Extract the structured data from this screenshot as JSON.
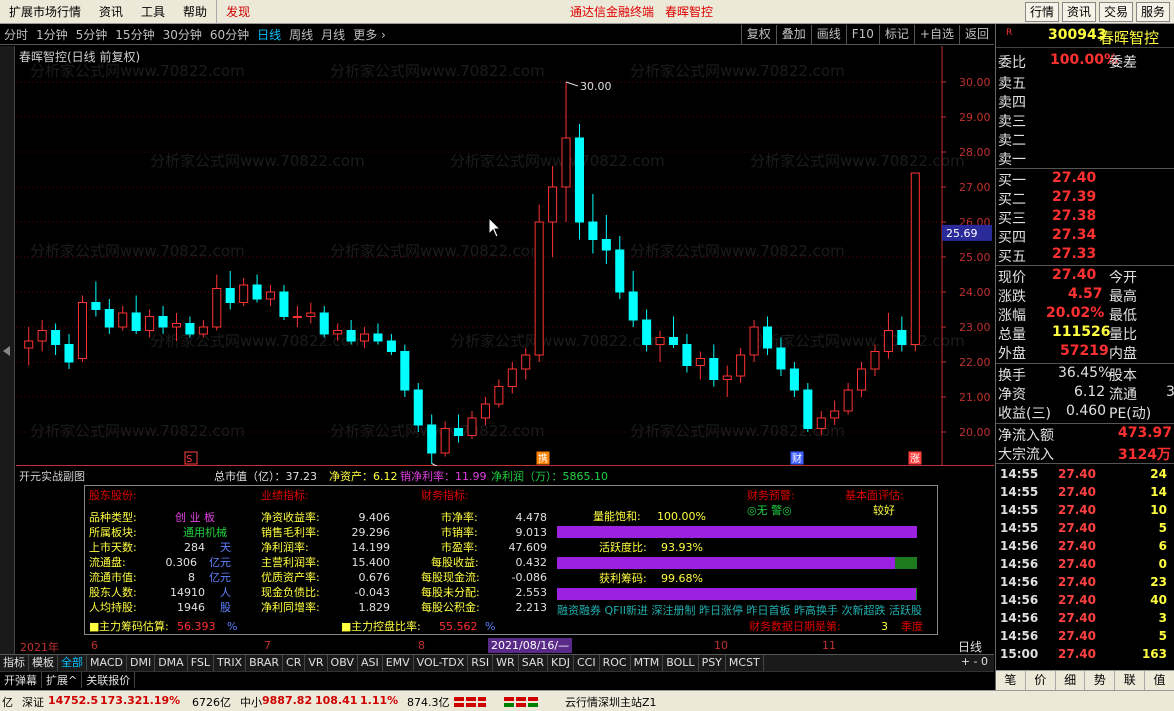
{
  "menu": {
    "items": [
      "扩展市场行情",
      "资讯",
      "工具",
      "帮助"
    ],
    "find": "发现",
    "promo1": "通达信金融终端",
    "promo2": "春晖智控",
    "right_buttons": [
      "行情",
      "资讯",
      "交易",
      "服务"
    ]
  },
  "periods": [
    "分时",
    "1分钟",
    "5分钟",
    "15分钟",
    "30分钟",
    "60分钟",
    "日线",
    "周线",
    "月线",
    "更多 ›"
  ],
  "active_period": "日线",
  "tools": [
    "复权",
    "叠加",
    "画线",
    "F10",
    "标记",
    "+自选",
    "返回"
  ],
  "chart_title": "春晖智控(日线 前复权)",
  "watermark": "分析家公式网www.70822.com",
  "colors": {
    "up": "#ff3232",
    "down": "#00ffff",
    "axis": "#c03030",
    "grid": "#600000",
    "purple": "#9a22e0"
  },
  "chart_data": {
    "type": "candlestick",
    "title": "春晖智控(日线 前复权)",
    "ylim": [
      19.02,
      30.0
    ],
    "yticks": [
      "30.00",
      "29.00",
      "28.00",
      "27.00",
      "26.00",
      "25.00",
      "24.00",
      "23.00",
      "22.00",
      "21.00",
      "20.00"
    ],
    "last_price_label": "25.69",
    "high_marker": "30.00",
    "low_marker": "19.02",
    "candles": [
      [
        22.4,
        23.0,
        21.9,
        22.6
      ],
      [
        22.6,
        23.2,
        22.3,
        22.9
      ],
      [
        22.9,
        23.1,
        22.2,
        22.5
      ],
      [
        22.5,
        22.8,
        21.8,
        22.0
      ],
      [
        22.1,
        23.9,
        22.0,
        23.7
      ],
      [
        23.7,
        24.3,
        23.3,
        23.5
      ],
      [
        23.5,
        23.8,
        22.8,
        23.0
      ],
      [
        23.0,
        23.6,
        22.9,
        23.4
      ],
      [
        23.4,
        23.9,
        22.8,
        22.9
      ],
      [
        22.9,
        23.5,
        22.7,
        23.3
      ],
      [
        23.3,
        23.6,
        22.8,
        23.0
      ],
      [
        23.0,
        23.4,
        22.6,
        23.1
      ],
      [
        23.1,
        23.3,
        22.7,
        22.8
      ],
      [
        22.8,
        23.2,
        22.7,
        23.0
      ],
      [
        23.0,
        24.5,
        22.9,
        24.1
      ],
      [
        24.1,
        24.6,
        23.5,
        23.7
      ],
      [
        23.7,
        24.4,
        23.6,
        24.2
      ],
      [
        24.2,
        24.5,
        23.7,
        23.8
      ],
      [
        23.8,
        24.2,
        23.6,
        24.0
      ],
      [
        24.0,
        24.2,
        23.2,
        23.3
      ],
      [
        23.3,
        23.6,
        23.0,
        23.3
      ],
      [
        23.3,
        23.7,
        23.1,
        23.4
      ],
      [
        23.4,
        23.6,
        22.7,
        22.8
      ],
      [
        22.8,
        23.1,
        22.6,
        22.9
      ],
      [
        22.9,
        23.2,
        22.5,
        22.6
      ],
      [
        22.6,
        23.0,
        22.4,
        22.8
      ],
      [
        22.8,
        23.1,
        22.5,
        22.6
      ],
      [
        22.6,
        22.8,
        22.2,
        22.3
      ],
      [
        22.3,
        22.5,
        21.0,
        21.2
      ],
      [
        21.2,
        21.4,
        20.0,
        20.2
      ],
      [
        20.2,
        20.5,
        19.1,
        19.4
      ],
      [
        19.4,
        20.3,
        19.3,
        20.1
      ],
      [
        20.1,
        20.5,
        19.7,
        19.9
      ],
      [
        19.9,
        20.6,
        19.8,
        20.4
      ],
      [
        20.4,
        21.0,
        20.2,
        20.8
      ],
      [
        20.8,
        21.5,
        20.7,
        21.3
      ],
      [
        21.3,
        22.0,
        21.1,
        21.8
      ],
      [
        21.8,
        22.4,
        21.5,
        22.2
      ],
      [
        22.2,
        26.5,
        22.0,
        26.0
      ],
      [
        26.0,
        27.6,
        25.0,
        27.0
      ],
      [
        27.0,
        30.0,
        26.0,
        28.4
      ],
      [
        28.4,
        28.8,
        25.5,
        26.0
      ],
      [
        26.0,
        26.8,
        25.1,
        25.5
      ],
      [
        25.5,
        26.2,
        24.8,
        25.2
      ],
      [
        25.2,
        25.6,
        23.8,
        24.0
      ],
      [
        24.0,
        24.6,
        23.0,
        23.2
      ],
      [
        23.2,
        23.5,
        22.3,
        22.5
      ],
      [
        22.5,
        22.9,
        22.0,
        22.7
      ],
      [
        22.7,
        23.3,
        22.4,
        22.5
      ],
      [
        22.5,
        22.8,
        21.7,
        21.9
      ],
      [
        21.9,
        22.3,
        21.5,
        22.1
      ],
      [
        22.1,
        22.5,
        21.3,
        21.5
      ],
      [
        21.5,
        21.9,
        21.0,
        21.6
      ],
      [
        21.6,
        22.4,
        21.4,
        22.2
      ],
      [
        22.2,
        23.2,
        22.0,
        23.0
      ],
      [
        23.0,
        23.3,
        22.2,
        22.4
      ],
      [
        22.4,
        22.7,
        21.6,
        21.8
      ],
      [
        21.8,
        22.0,
        21.0,
        21.2
      ],
      [
        21.2,
        21.4,
        20.0,
        20.1
      ],
      [
        20.1,
        20.6,
        19.9,
        20.4
      ],
      [
        20.4,
        20.9,
        20.2,
        20.6
      ],
      [
        20.6,
        21.4,
        20.5,
        21.2
      ],
      [
        21.2,
        22.0,
        21.0,
        21.8
      ],
      [
        21.8,
        22.5,
        21.6,
        22.3
      ],
      [
        22.3,
        23.4,
        22.1,
        22.9
      ],
      [
        22.9,
        23.3,
        22.3,
        22.5
      ],
      [
        22.5,
        27.4,
        22.3,
        27.4
      ]
    ]
  },
  "markers": {
    "s": "S",
    "ex": "携",
    "cai": "财",
    "zhang": "涨"
  },
  "fund": {
    "title": "开元实战副图",
    "mktcap": "总市值（亿）：37.23",
    "netasset": "净资产：6.12",
    "grossrate": "销净利率：11.99",
    "netprofit": "净利润（万）：5865.10",
    "h1": "股东股份:",
    "h2": "业绩指标:",
    "h3": "财务指标:",
    "h4": "财务预警:",
    "h5": "基本面评估:",
    "warn": "◎无 警◎",
    "eval": "较好",
    "c1": [
      [
        "品种类型:",
        "创 业 板",
        ""
      ],
      [
        "所属板块:",
        "通用机械",
        ""
      ],
      [
        "上市天数:",
        "284",
        "天"
      ],
      [
        "流通盘:",
        "0.306",
        "亿元"
      ],
      [
        "流通市值:",
        "8",
        "亿元"
      ],
      [
        "股东人数:",
        "14910",
        "人"
      ],
      [
        "人均持股:",
        "1946",
        "股"
      ]
    ],
    "c2": [
      [
        "净资收益率:",
        "9.406"
      ],
      [
        "销售毛利率:",
        "29.296"
      ],
      [
        "净利润率:",
        "14.199"
      ],
      [
        "主营利润率:",
        "15.400"
      ],
      [
        "优质资产率:",
        "0.676"
      ],
      [
        "现金负债比:",
        "-0.043"
      ],
      [
        "净利同增率:",
        "1.829"
      ]
    ],
    "c3": [
      [
        "市净率:",
        "4.478"
      ],
      [
        "市销率:",
        "9.013"
      ],
      [
        "市盈率:",
        "47.609"
      ],
      [
        "每股收益:",
        "0.432"
      ],
      [
        "每股现金流:",
        "-0.086"
      ],
      [
        "每股未分配:",
        "2.553"
      ],
      [
        "每股公积金:",
        "2.213"
      ]
    ],
    "bars": [
      {
        "label": "量能饱和:",
        "pct": "100.00%",
        "fill": 1.0
      },
      {
        "label": "活跃度比:",
        "pct": "93.93%",
        "fill": 0.9393
      },
      {
        "label": "获利筹码:",
        "pct": "99.68%",
        "fill": 0.9968
      }
    ],
    "scroller": "融资融券 QFII新进 深注册制 昨日涨停 昨日首板 昨高换手 次新超跌 活跃股",
    "chip1": "主力筹码估算:",
    "chip1v": "56.393",
    "chip1u": "%",
    "chip2": "主力控盘比率:",
    "chip2v": "55.562",
    "chip2u": "%",
    "reportdate": "财务数据日期是第:",
    "reportq": "3",
    "reportu": "季度"
  },
  "timeaxis": {
    "labels": [
      "2021年",
      "6",
      "7",
      "8",
      "10",
      "11"
    ],
    "current": "2021/08/16/—",
    "period": "日线"
  },
  "indicators": [
    "指标",
    "模板",
    "全部",
    "MACD",
    "DMI",
    "DMA",
    "FSL",
    "TRIX",
    "BRAR",
    "CR",
    "VR",
    "OBV",
    "ASI",
    "EMV",
    "VOL-TDX",
    "RSI",
    "WR",
    "SAR",
    "KDJ",
    "CCI",
    "ROC",
    "MTM",
    "BOLL",
    "PSY",
    "MCST"
  ],
  "ind_controls": "+ - 0",
  "subbar": [
    "开弹幕",
    "扩展^",
    "关联报价"
  ],
  "status": {
    "s1": "亿",
    "szzs": "深证",
    "szv": "14752.5",
    "szc": "173.32",
    "szp": "1.19%",
    "szamt": "6726亿",
    "zx": "中小",
    "zxv": "9887.82",
    "zxc": "108.41",
    "zxp": "1.11%",
    "zxamt": "874.3亿",
    "server": "云行情深圳主站Z1"
  },
  "quote": {
    "code": "300943",
    "name": "春晖智控",
    "flag": "R",
    "webi": "委比",
    "webi_v": "100.00%",
    "weicha": "委差",
    "asks": [
      "卖五",
      "卖四",
      "卖三",
      "卖二",
      "卖一"
    ],
    "bids": [
      [
        "买一",
        "27.40"
      ],
      [
        "买二",
        "27.39"
      ],
      [
        "买三",
        "27.38"
      ],
      [
        "买四",
        "27.34"
      ],
      [
        "买五",
        "27.33"
      ]
    ],
    "stats": [
      [
        "现价",
        "27.40",
        "今开",
        "red"
      ],
      [
        "涨跌",
        "4.57",
        "最高",
        "red"
      ],
      [
        "涨幅",
        "20.02%",
        "最低",
        "red"
      ],
      [
        "总量",
        "111526",
        "量比",
        "yellow"
      ],
      [
        "外盘",
        "57219",
        "内盘",
        "red"
      ],
      [
        "换手",
        "36.45%",
        "股本",
        "white"
      ],
      [
        "净资",
        "6.12",
        "流通",
        "white"
      ],
      [
        "收益(三)",
        "0.460",
        "PE(动)",
        "white"
      ]
    ],
    "liutong_extra": "3",
    "netflow_label": "净流入额",
    "netflow_v": "473.97",
    "bigflow_label": "大宗流入",
    "bigflow_v": "3124万",
    "ticks": [
      [
        "14:55",
        "27.40",
        "24"
      ],
      [
        "14:55",
        "27.40",
        "14"
      ],
      [
        "14:55",
        "27.40",
        "10"
      ],
      [
        "14:55",
        "27.40",
        "5"
      ],
      [
        "14:56",
        "27.40",
        "6"
      ],
      [
        "14:56",
        "27.40",
        "0"
      ],
      [
        "14:56",
        "27.40",
        "23"
      ],
      [
        "14:56",
        "27.40",
        "40"
      ],
      [
        "14:56",
        "27.40",
        "3"
      ],
      [
        "14:56",
        "27.40",
        "5"
      ],
      [
        "15:00",
        "27.40",
        "163"
      ]
    ],
    "tabs": [
      "笔",
      "价",
      "细",
      "势",
      "联",
      "值"
    ]
  }
}
